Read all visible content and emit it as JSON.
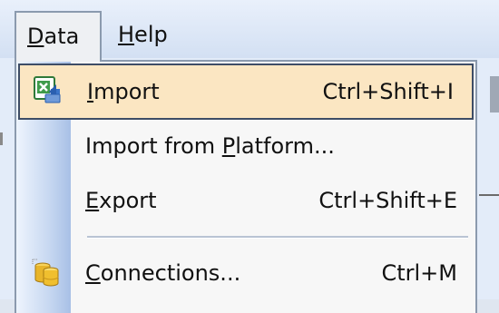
{
  "menubar": {
    "data_label": "Data",
    "data_label_pre": "",
    "data_label_mn": "D",
    "data_label_post": "ata",
    "help_label_mn": "H",
    "help_label_post": "elp"
  },
  "dropdown": {
    "items": [
      {
        "label_pre": "",
        "label_mn": "I",
        "label_post": "mport",
        "shortcut": "Ctrl+Shift+I",
        "icon": "excel-import-icon",
        "highlighted": true
      },
      {
        "label_pre": "Import from ",
        "label_mn": "P",
        "label_post": "latform...",
        "shortcut": "",
        "icon": "",
        "highlighted": false
      },
      {
        "label_pre": "",
        "label_mn": "E",
        "label_post": "xport",
        "shortcut": "Ctrl+Shift+E",
        "icon": "",
        "highlighted": false
      },
      {
        "label_pre": "",
        "label_mn": "C",
        "label_post": "onnections...",
        "shortcut": "Ctrl+M",
        "icon": "database-connections-icon",
        "highlighted": false
      }
    ]
  },
  "colors": {
    "highlight_fill": "#fbe6c2",
    "highlight_border": "#3e4d66",
    "menu_border": "#8b9aae",
    "icon_strip": "#c7d8f1"
  }
}
